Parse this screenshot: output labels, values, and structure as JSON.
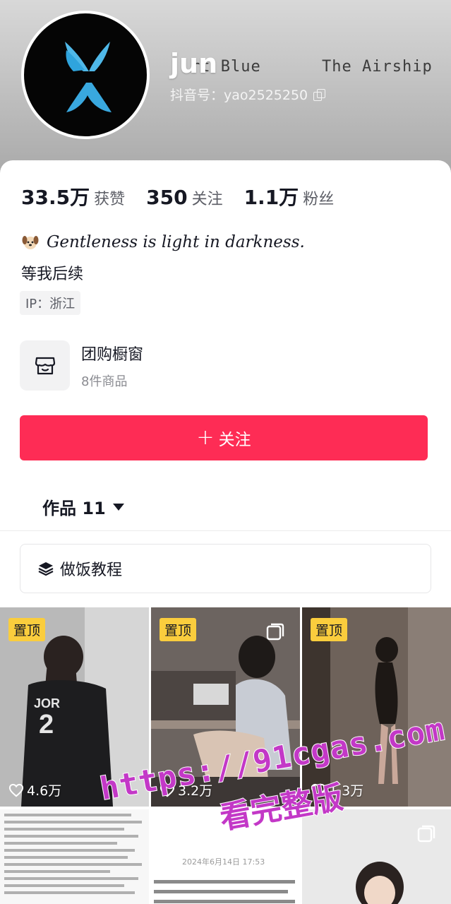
{
  "header": {
    "banner_text_1": "rt Blue",
    "banner_text_2": "The Airship",
    "username": "jun",
    "douyin_id": "抖音号：yao2525250"
  },
  "stats": [
    {
      "value": "33.5万",
      "label": "获赞"
    },
    {
      "value": "350",
      "label": "关注"
    },
    {
      "value": "1.1万",
      "label": "粉丝"
    }
  ],
  "bio": {
    "line1": "Gentleness is light in darkness.",
    "line2": "等我后续",
    "ip": "IP：浙江"
  },
  "shop": {
    "title": "团购橱窗",
    "subtitle": "8件商品"
  },
  "follow_button": {
    "label": "关注",
    "color": "#fe2c55"
  },
  "works_tab": {
    "label": "作品 11"
  },
  "playlist": {
    "label": "做饭教程"
  },
  "videos": [
    {
      "pinned": true,
      "pin_label": "置顶",
      "likes": "4.6万",
      "multi": false
    },
    {
      "pinned": true,
      "pin_label": "置顶",
      "likes": "3.2万",
      "multi": true
    },
    {
      "pinned": true,
      "pin_label": "置顶",
      "likes": "1.3万",
      "multi": false
    },
    {
      "pinned": false,
      "note_date": "2024年6月14日 17:53",
      "multi": false
    },
    {
      "pinned": false,
      "multi": false
    },
    {
      "pinned": false,
      "multi": true
    }
  ],
  "watermark": {
    "line1": "https://91cgas.com",
    "line2": "看完整版"
  },
  "colors": {
    "pin_badge": "#facd3d",
    "watermark": "#c338c7"
  }
}
